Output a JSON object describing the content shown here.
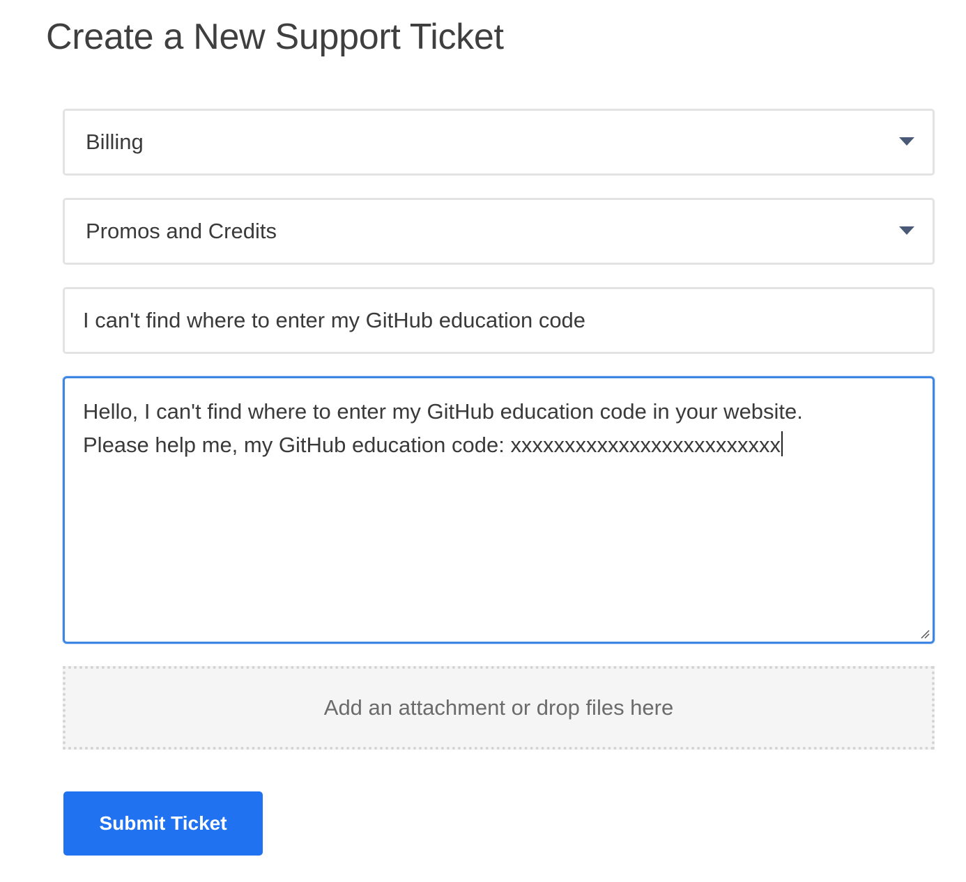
{
  "page": {
    "title": "Create a New Support Ticket"
  },
  "form": {
    "category": {
      "selected": "Billing",
      "icon": "chevron-down-icon"
    },
    "subcategory": {
      "selected": "Promos and Credits",
      "icon": "chevron-down-icon"
    },
    "subject": {
      "value": "I can't find where to enter my GitHub education code"
    },
    "message": {
      "value": "Hello, I can't find where to enter my GitHub education code in your website.\nPlease help me, my GitHub education code: xxxxxxxxxxxxxxxxxxxxxxxxx"
    },
    "attachment": {
      "label": "Add an attachment or drop files here"
    },
    "submit": {
      "label": "Submit Ticket"
    }
  },
  "colors": {
    "accent": "#2172f0",
    "focus_border": "#3d87e3",
    "caret_icon": "#4a5a76"
  }
}
